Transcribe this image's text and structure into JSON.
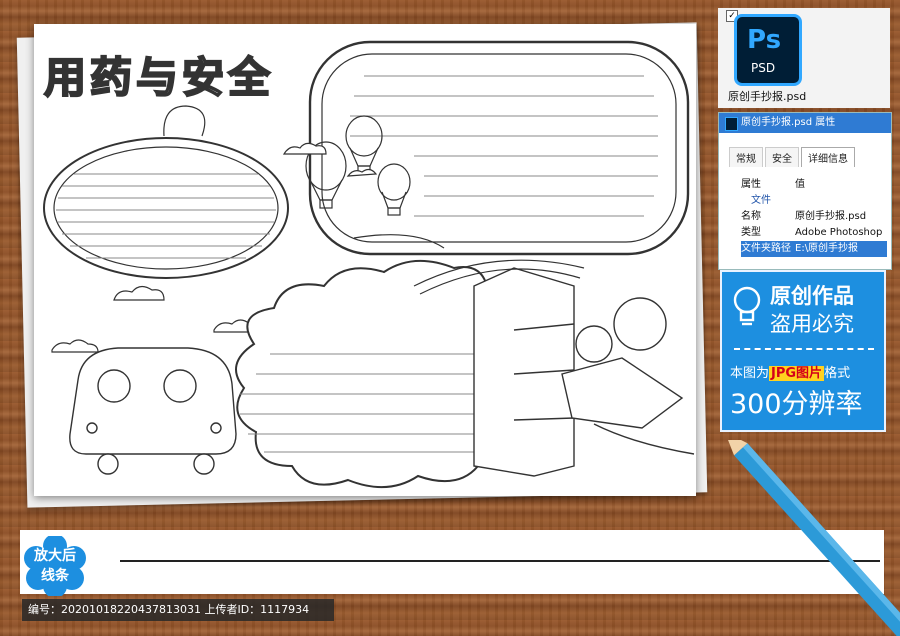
{
  "handout": {
    "title": "用药与安全"
  },
  "ps_file": {
    "icon_label": "Ps",
    "icon_sub": "PSD",
    "filename": "原创手抄报.psd"
  },
  "properties": {
    "window_title": "原创手抄报.psd 属性",
    "tabs": [
      "常规",
      "安全",
      "详细信息"
    ],
    "header": {
      "key": "属性",
      "value": "值"
    },
    "section": "文件",
    "rows": [
      {
        "key": "名称",
        "value": "原创手抄报.psd"
      },
      {
        "key": "类型",
        "value": "Adobe Photoshop"
      },
      {
        "key": "文件夹路径",
        "value": "E:\\原创手抄报"
      }
    ]
  },
  "promo": {
    "line1": "原创作品",
    "line2": "盗用必究",
    "line3_pre": "本图为",
    "line3_hl": "JPG图片",
    "line3_post": "格式",
    "line4": "300分辨率"
  },
  "zoom_badge": {
    "line1": "放大后",
    "line2": "线条"
  },
  "footer": {
    "text": "编号：20201018220437813031 上传者ID：1117934"
  },
  "colors": {
    "wood": "#8c4f26",
    "promo_blue": "#1d8fe0",
    "ps_blue": "#31a8ff",
    "ps_dark": "#001e36",
    "highlight": "#ffd21f"
  }
}
